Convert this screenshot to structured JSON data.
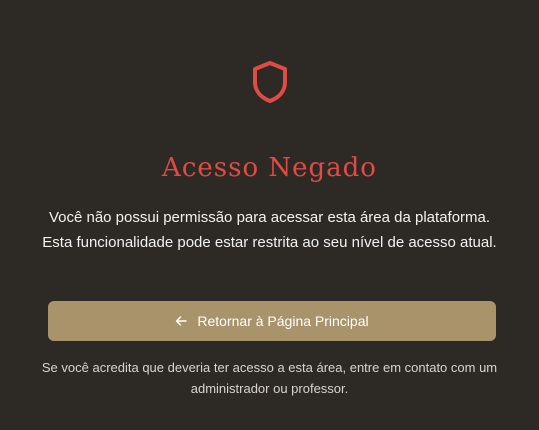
{
  "colors": {
    "background": "#2d2a25",
    "accent_red": "#e04b44",
    "button_bg": "#a8936b",
    "text": "#ffffff",
    "muted_text": "#d8d4cd"
  },
  "header": {
    "icon": "shield-icon",
    "title": "Acesso Negado"
  },
  "main": {
    "message": "Você não possui permissão para acessar esta área da plataforma. Esta funcionalidade pode estar restrita ao seu nível de acesso atual.",
    "button": {
      "icon": "arrow-left-icon",
      "label": "Retornar à Página Principal"
    },
    "note": "Se você acredita que deveria ter acesso a esta área, entre em contato com um administrador ou professor."
  }
}
